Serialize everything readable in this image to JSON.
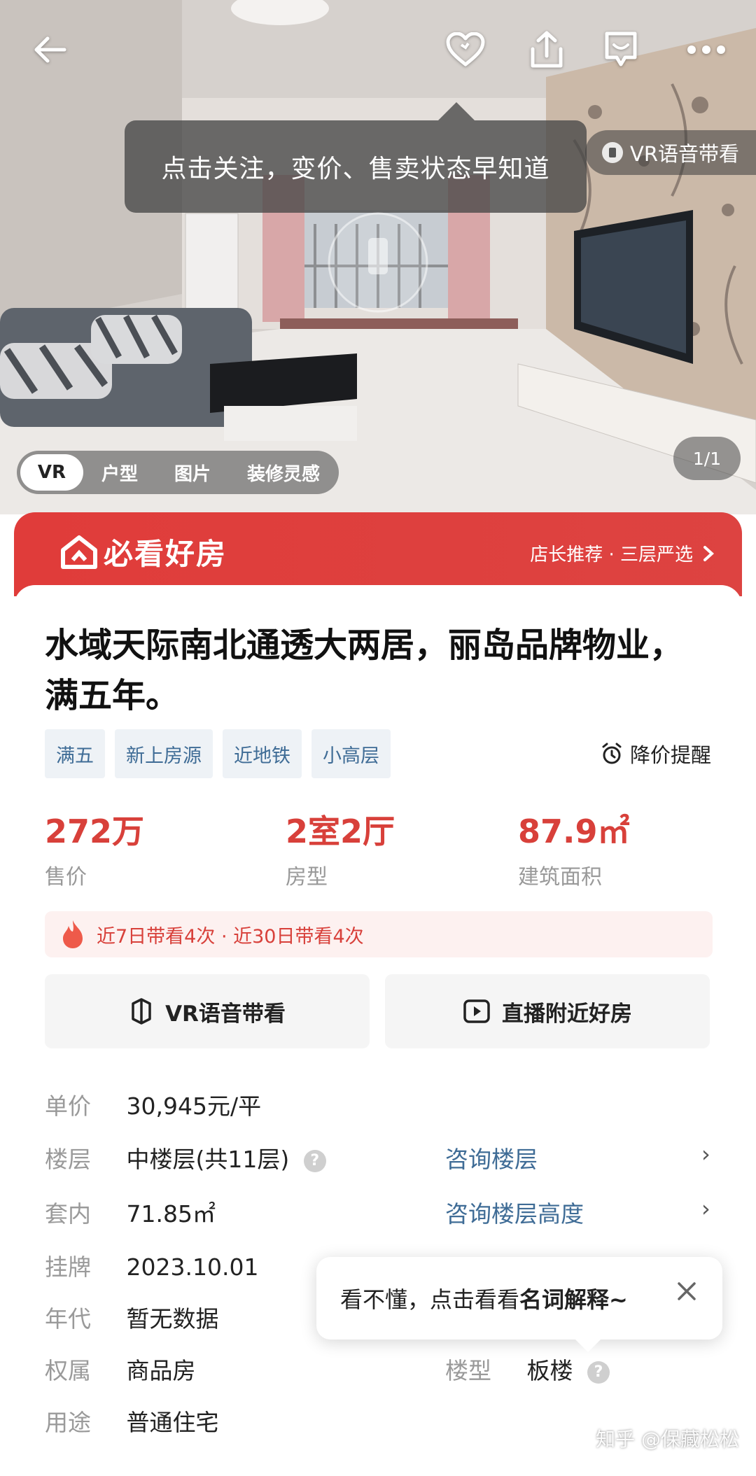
{
  "hero": {
    "follow_tip": "点击关注，变价、售卖状态早知道",
    "vr_voice": "VR语音带看",
    "tabs": [
      "VR",
      "户型",
      "图片",
      "装修灵感"
    ],
    "photo_count": "1/1"
  },
  "banner": {
    "brand": "必看好房",
    "right_text": "店长推荐 · 三层严选"
  },
  "listing": {
    "title": "水域天际南北通透大两居，丽岛品牌物业，满五年。",
    "tags": [
      "满五",
      "新上房源",
      "近地铁",
      "小高层"
    ],
    "price_alert": "降价提醒",
    "stats": [
      {
        "value": "272万",
        "label": "售价"
      },
      {
        "value": "2室2厅",
        "label": "房型"
      },
      {
        "value": "87.9㎡",
        "label": "建筑面积"
      }
    ],
    "heat": "近7日带看4次 · 近30日带看4次",
    "buttons": {
      "vr": "VR语音带看",
      "live": "直播附近好房"
    },
    "details": {
      "unit_price_k": "单价",
      "unit_price_v": "30,945元/平",
      "floor_k": "楼层",
      "floor_v": "中楼层(共11层)",
      "inner_k": "套内",
      "inner_v": "71.85㎡",
      "listed_k": "挂牌",
      "listed_v": "2023.10.01",
      "age_k": "年代",
      "age_v": "暂无数据",
      "ownership_k": "权属",
      "ownership_v": "商品房",
      "use_k": "用途",
      "use_v": "普通住宅",
      "type_k": "楼型",
      "type_v": "板楼",
      "consult_floor": "咨询楼层",
      "consult_height": "咨询楼层高度"
    }
  },
  "tooltip": {
    "prefix": "看不懂，点击看看",
    "bold": "名词解释~"
  },
  "watermark": "知乎 @保藏松松",
  "colors": {
    "accent_red": "#d8403a",
    "banner_red": "#e03c3a",
    "link_blue": "#3f6c96"
  }
}
